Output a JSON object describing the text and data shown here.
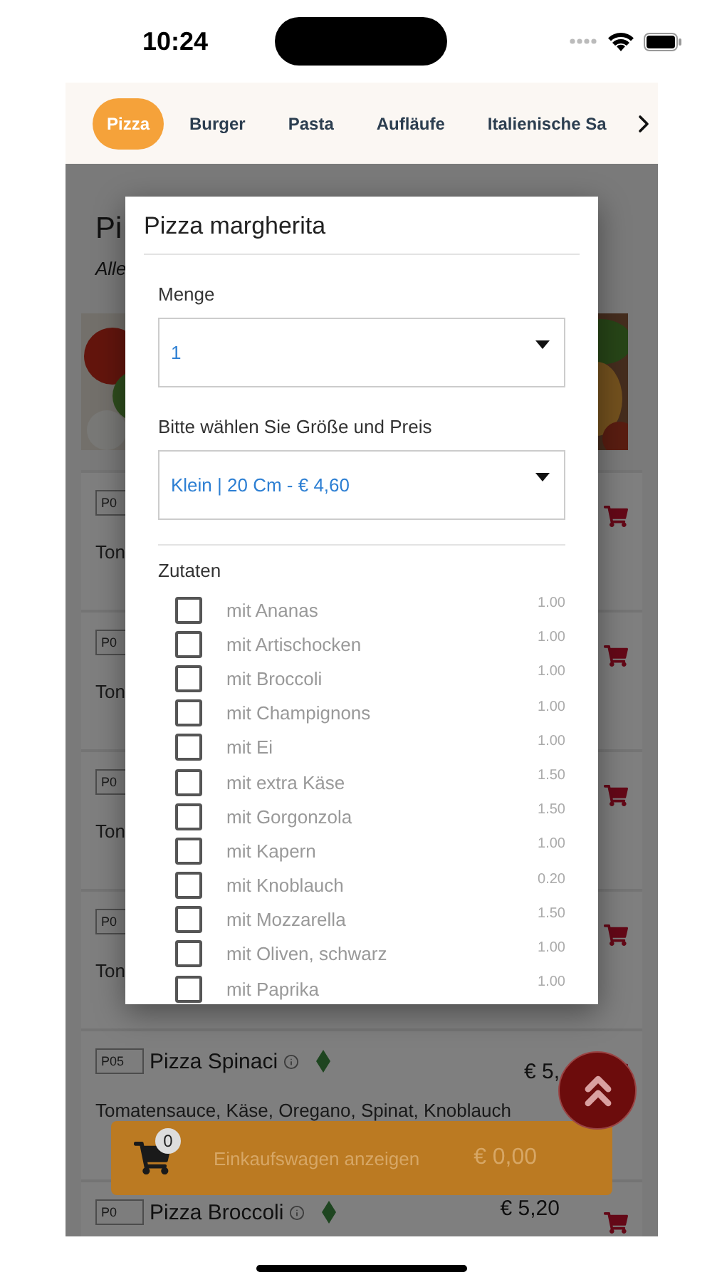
{
  "status_bar": {
    "time": "10:24"
  },
  "tabs": [
    {
      "label": "Pizza",
      "selected": true
    },
    {
      "label": "Burger",
      "selected": false
    },
    {
      "label": "Pasta",
      "selected": false
    },
    {
      "label": "Aufläufe",
      "selected": false
    },
    {
      "label": "Italienische Sa",
      "selected": false
    }
  ],
  "page": {
    "heading": "Pi",
    "subtitle": "Alle",
    "rows": [
      {
        "code": "P0",
        "description": "Ton"
      },
      {
        "code": "P0",
        "description": "Ton"
      },
      {
        "code": "P0",
        "description": "Ton"
      },
      {
        "code": "P0",
        "description": "Ton"
      }
    ],
    "products": [
      {
        "code": "P05",
        "name": "Pizza Spinaci",
        "price": "€ 5,",
        "description": "Tomatensauce, Käse, Oregano, Spinat, Knoblauch"
      },
      {
        "code": "P0",
        "name": "Pizza Broccoli",
        "price": "€ 5,20"
      }
    ]
  },
  "dialog": {
    "title": "Pizza margherita",
    "quantity_label": "Menge",
    "quantity": "1",
    "size_label": "Bitte wählen Sie Größe und Preis",
    "size": "Klein | 20 Cm - € 4,60",
    "extras_label": "Zutaten",
    "extras": [
      {
        "name": "mit Ananas",
        "price": "1.00",
        "checked": false
      },
      {
        "name": "mit Artischocken",
        "price": "1.00",
        "checked": false
      },
      {
        "name": "mit Broccoli",
        "price": "1.00",
        "checked": false
      },
      {
        "name": "mit Champignons",
        "price": "1.00",
        "checked": false
      },
      {
        "name": "mit Ei",
        "price": "1.00",
        "checked": false
      },
      {
        "name": "mit extra Käse",
        "price": "1.50",
        "checked": false
      },
      {
        "name": "mit Gorgonzola",
        "price": "1.50",
        "checked": false
      },
      {
        "name": "mit Kapern",
        "price": "1.00",
        "checked": false
      },
      {
        "name": "mit Knoblauch",
        "price": "0.20",
        "checked": false
      },
      {
        "name": "mit Mozzarella",
        "price": "1.50",
        "checked": false
      },
      {
        "name": "mit Oliven, schwarz",
        "price": "1.00",
        "checked": false
      },
      {
        "name": "mit Paprika",
        "price": "1.00",
        "checked": false
      }
    ]
  },
  "cart_bar": {
    "count": "0",
    "label": "Einkaufswagen anzeigen",
    "total": "€ 0,00"
  }
}
